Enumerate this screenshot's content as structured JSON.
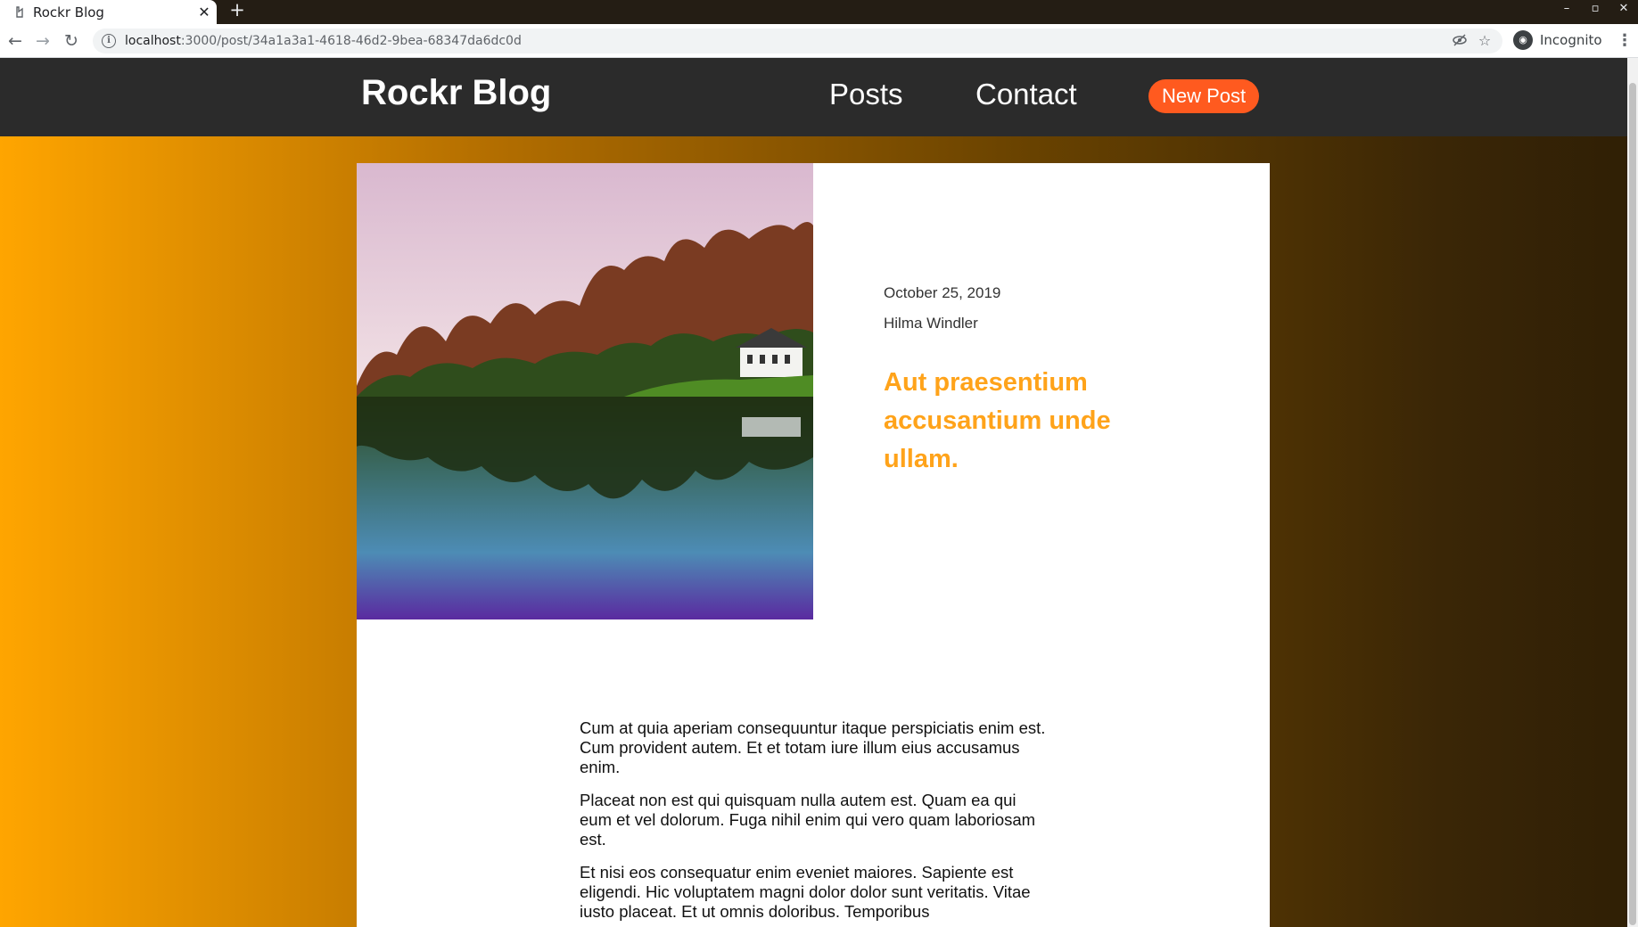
{
  "browser": {
    "tab_title": "Rockr Blog",
    "tab_close": "✕",
    "new_tab": "+",
    "url_host": "localhost",
    "url_rest": ":3000/post/34a1a3a1-4618-46d2-9bea-68347da6dc0d",
    "profile_label": "Incognito",
    "window_controls": [
      "–",
      "▫",
      "✕"
    ]
  },
  "site": {
    "brand": "Rockr Blog",
    "nav": {
      "posts": "Posts",
      "contact": "Contact",
      "new_post": "New Post"
    },
    "colors": {
      "header_bg": "#2b2b2b",
      "accent_button": "#ff5a1f",
      "title_color": "#ffa31a",
      "gradient_start": "#ffa500",
      "gradient_end": "#2f1f05"
    }
  },
  "post": {
    "date": "October 25, 2019",
    "author": "Hilma Windler",
    "title": "Aut praesentium accusantium unde ullam.",
    "paragraphs": [
      "Cum at quia aperiam consequuntur itaque perspiciatis enim est. Cum provident autem. Et et totam iure illum eius accusamus enim.",
      "Placeat non est qui quisquam nulla autem est. Quam ea qui eum et vel dolorum. Fuga nihil enim qui vero quam laboriosam est.",
      "Et nisi eos consequatur enim eveniet maiores. Sapiente est eligendi. Hic voluptatem magni dolor dolor sunt veritatis. Vitae iusto placeat. Et ut omnis doloribus. Temporibus"
    ]
  }
}
